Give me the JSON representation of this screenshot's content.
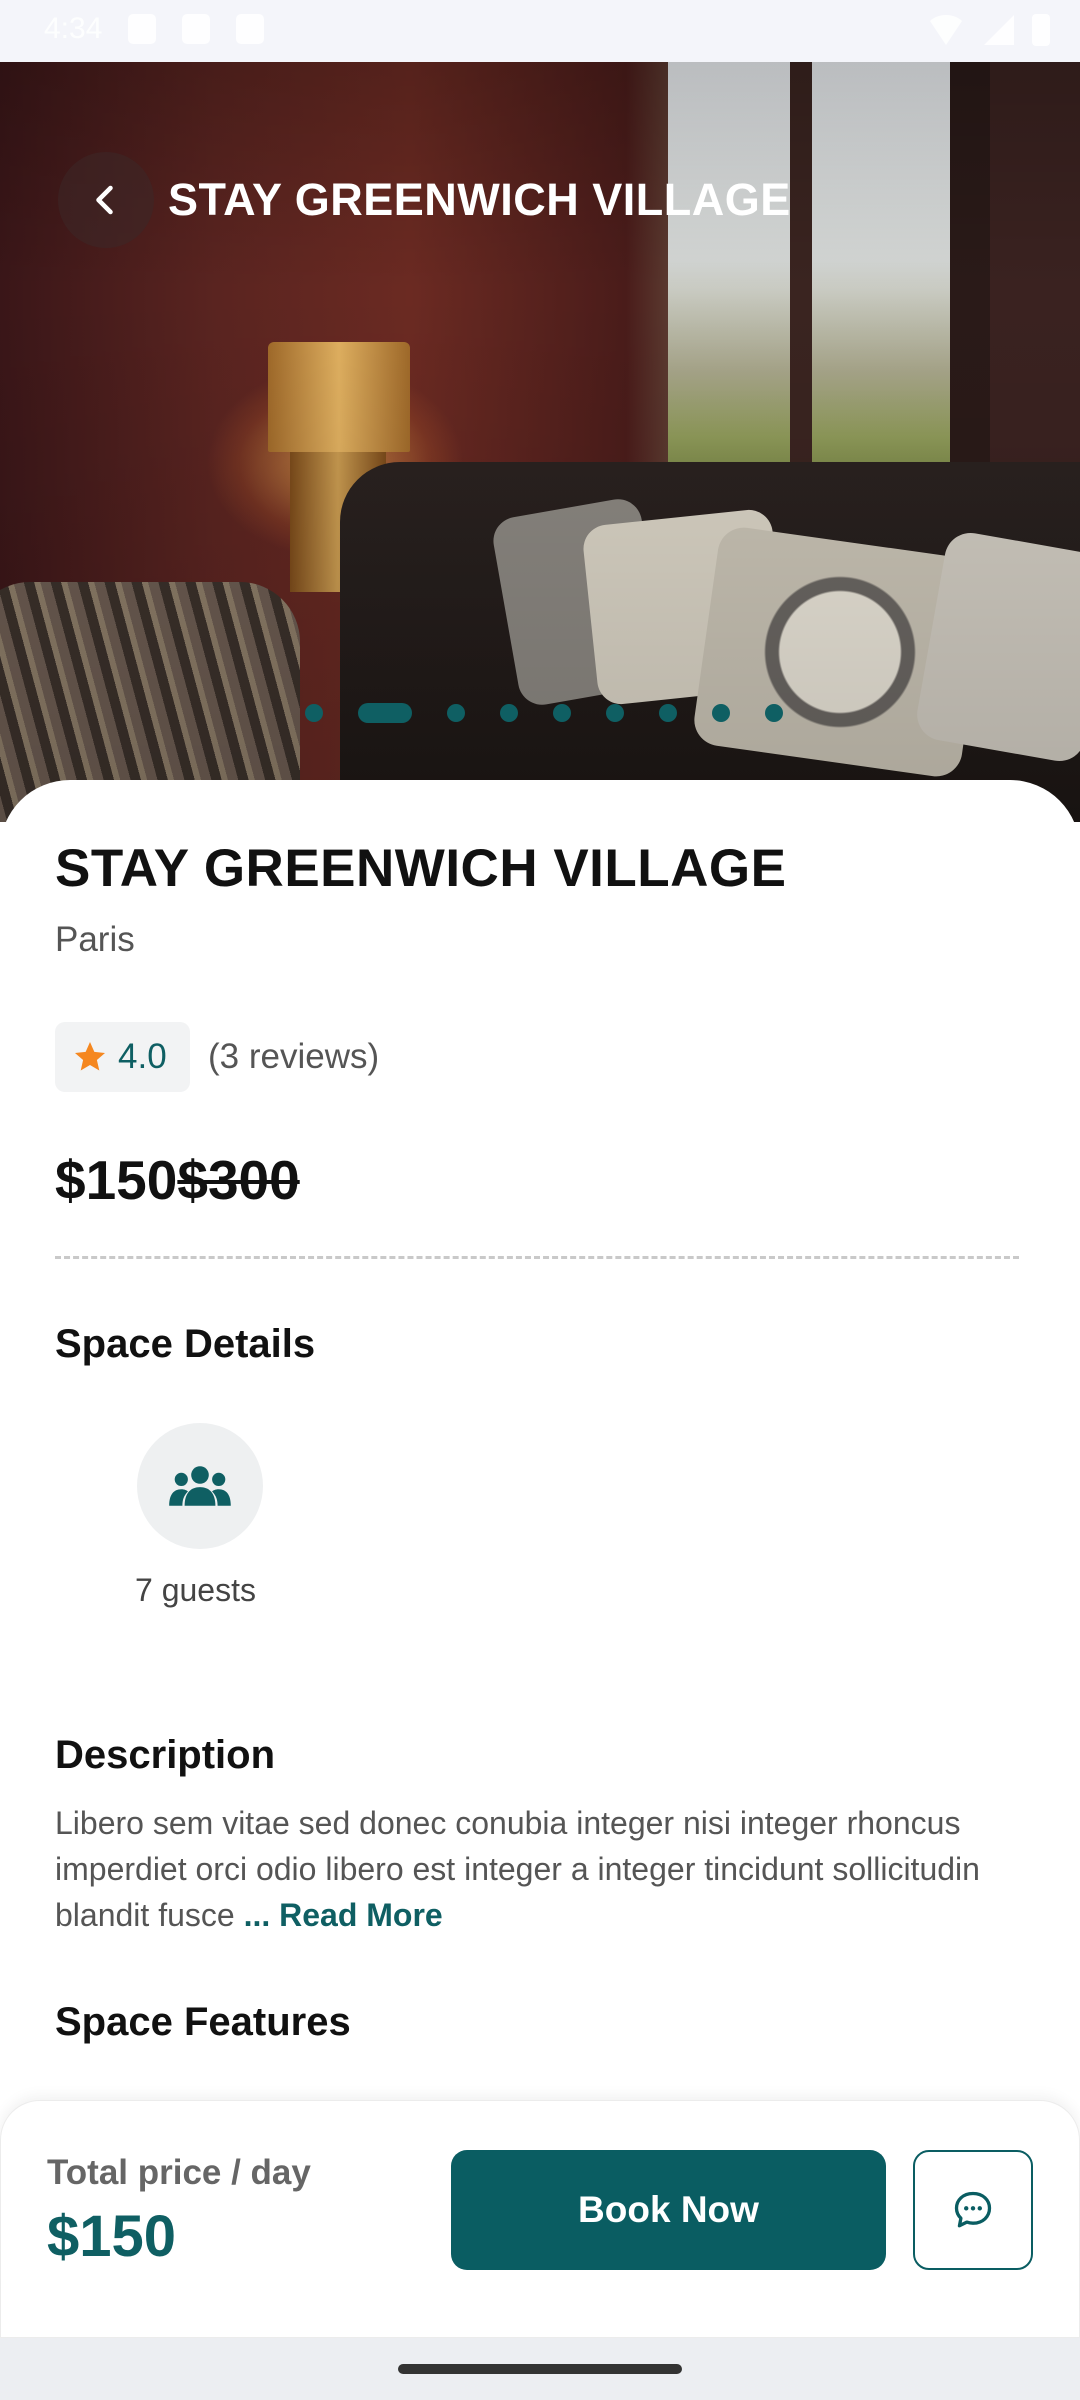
{
  "status_bar": {
    "time": "4:34"
  },
  "header": {
    "title": "STAY GREENWICH VILLAGE",
    "back_icon": "chevron-left-icon"
  },
  "carousel": {
    "total": 9,
    "active_index": 1
  },
  "listing": {
    "title": "STAY GREENWICH VILLAGE",
    "location": "Paris",
    "rating": "4.0",
    "reviews": "(3 reviews)",
    "price": "$150",
    "original_price": "$300"
  },
  "space_details": {
    "heading": "Space Details",
    "guests": "7 guests",
    "guests_icon": "people-icon"
  },
  "description": {
    "heading": "Description",
    "text": "Libero sem vitae sed donec conubia integer nisi integer rhoncus imperdiet orci odio libero est integer a integer tincidunt sollicitudin blandit fusce",
    "read_more": "... Read More"
  },
  "space_features": {
    "heading": "Space Features"
  },
  "bottom_bar": {
    "total_label": "Total price / day",
    "total_value": "$150",
    "book_label": "Book Now",
    "chat_icon": "chat-bubble-icon"
  },
  "colors": {
    "accent": "#0a5d62",
    "star": "#f5871f"
  }
}
